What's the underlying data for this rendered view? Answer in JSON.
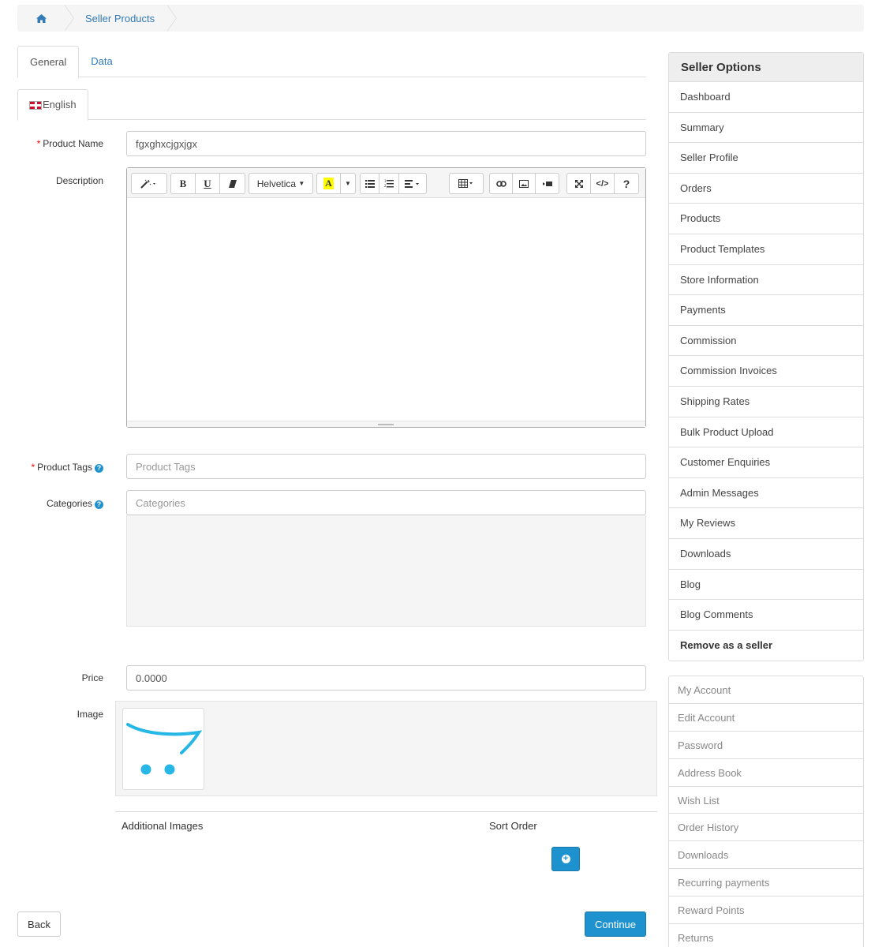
{
  "breadcrumb": {
    "current": "Seller Products"
  },
  "tabs": [
    {
      "label": "General"
    },
    {
      "label": "Data"
    }
  ],
  "language_tab": {
    "label": "English"
  },
  "form": {
    "product_name": {
      "label": "Product Name",
      "value": "fgxghxcjgxjgx"
    },
    "description": {
      "label": "Description"
    },
    "product_tags": {
      "label": "Product Tags",
      "placeholder": "Product Tags"
    },
    "categories": {
      "label": "Categories",
      "placeholder": "Categories"
    },
    "price": {
      "label": "Price",
      "value": "0.0000"
    },
    "image": {
      "label": "Image"
    }
  },
  "editor": {
    "font_label": "Helvetica",
    "bold": "B",
    "underline": "U",
    "color_letter": "A",
    "code": "</>",
    "help": "?"
  },
  "additional_images": {
    "image_col": "Additional Images",
    "sort_col": "Sort Order"
  },
  "buttons": {
    "back": "Back",
    "continue": "Continue"
  },
  "seller_options": {
    "title": "Seller Options",
    "items": [
      "Dashboard",
      "Summary",
      "Seller Profile",
      "Orders",
      "Products",
      "Product Templates",
      "Store Information",
      "Payments",
      "Commission",
      "Commission Invoices",
      "Shipping Rates",
      "Bulk Product Upload",
      "Customer Enquiries",
      "Admin Messages",
      "My Reviews",
      "Downloads",
      "Blog",
      "Blog Comments",
      "Remove as a seller"
    ]
  },
  "account_menu": {
    "items": [
      "My Account",
      "Edit Account",
      "Password",
      "Address Book",
      "Wish List",
      "Order History",
      "Downloads",
      "Recurring payments",
      "Reward Points",
      "Returns"
    ]
  },
  "colors": {
    "primary": "#1e91cf",
    "link": "#337ab7",
    "required": "#ff0000"
  }
}
